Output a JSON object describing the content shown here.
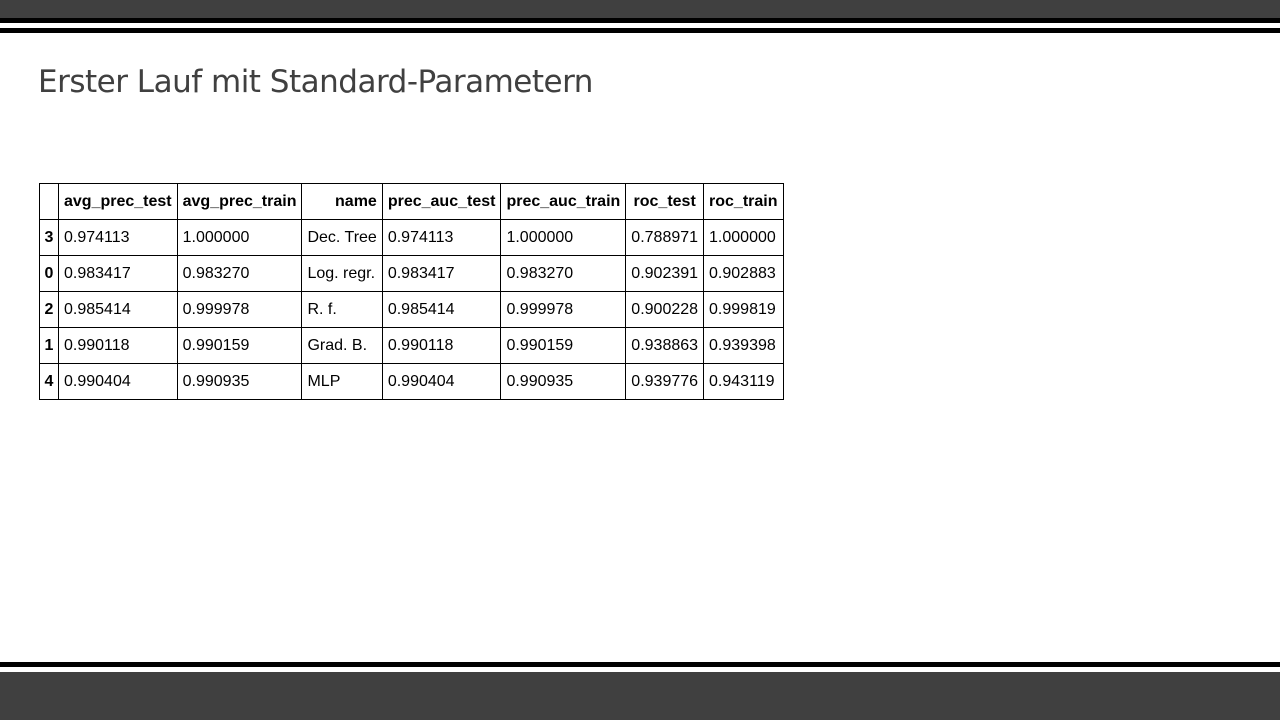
{
  "slide": {
    "title": "Erster Lauf mit Standard-Parametern"
  },
  "table": {
    "columns": [
      "",
      "avg_prec_test",
      "avg_prec_train",
      "name",
      "prec_auc_test",
      "prec_auc_train",
      "roc_test",
      "roc_train"
    ],
    "rows": [
      [
        "3",
        "0.974113",
        "1.000000",
        "Dec. Tree",
        "0.974113",
        "1.000000",
        "0.788971",
        "1.000000"
      ],
      [
        "0",
        "0.983417",
        "0.983270",
        "Log. regr.",
        "0.983417",
        "0.983270",
        "0.902391",
        "0.902883"
      ],
      [
        "2",
        "0.985414",
        "0.999978",
        "R. f.",
        "0.985414",
        "0.999978",
        "0.900228",
        "0.999819"
      ],
      [
        "1",
        "0.990118",
        "0.990159",
        "Grad. B.",
        "0.990118",
        "0.990159",
        "0.938863",
        "0.939398"
      ],
      [
        "4",
        "0.990404",
        "0.990935",
        "MLP",
        "0.990404",
        "0.990935",
        "0.939776",
        "0.943119"
      ]
    ]
  },
  "colors": {
    "band": "#404040",
    "rule": "#000000",
    "title": "#404040",
    "background": "#ffffff"
  }
}
